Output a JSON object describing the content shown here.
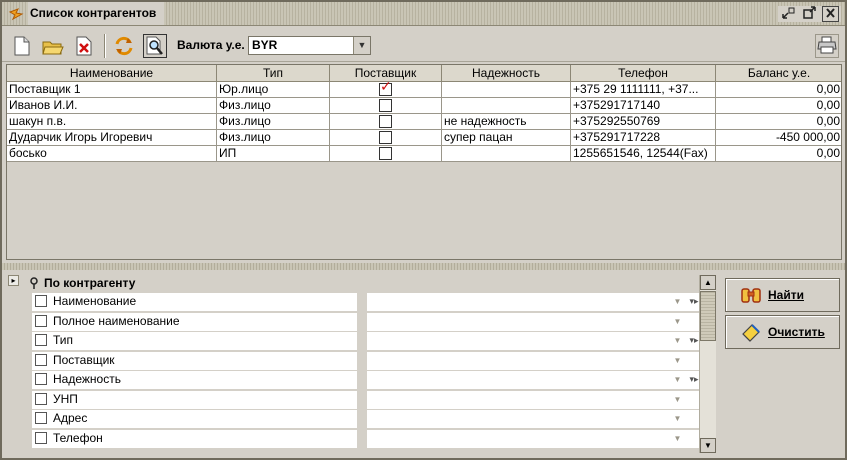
{
  "window": {
    "title": "Список контрагентов",
    "controls": {
      "minimize_label": "▫",
      "restore_label": "⇱",
      "close_label": "✕"
    }
  },
  "toolbar": {
    "currency_label": "Валюта у.е.",
    "currency_value": "BYR",
    "buttons": [
      "new-icon",
      "open-folder-icon",
      "delete-icon",
      "refresh-icon",
      "search-icon"
    ],
    "print_icon": "printer-icon"
  },
  "grid": {
    "columns": [
      "Наименование",
      "Тип",
      "Поставщик",
      "Надежность",
      "Телефон",
      "Баланс у.е."
    ],
    "rows": [
      {
        "name": "Поставщик 1",
        "type": "Юр.лицо",
        "supplier": true,
        "reliability": "",
        "phone": "+375 29 1111111, +37...",
        "balance": "0,00"
      },
      {
        "name": "Иванов И.И.",
        "type": "Физ.лицо",
        "supplier": false,
        "reliability": "",
        "phone": "+375291717140",
        "balance": "0,00"
      },
      {
        "name": "шакун п.в.",
        "type": "Физ.лицо",
        "supplier": false,
        "reliability": "не надежность",
        "phone": "+375292550769",
        "balance": "0,00"
      },
      {
        "name": "Дударчик Игорь Игоревич",
        "type": "Физ.лицо",
        "supplier": false,
        "reliability": "супер пацан",
        "phone": "+375291717228",
        "balance": "-450 000,00"
      },
      {
        "name": "босько",
        "type": "ИП",
        "supplier": false,
        "reliability": "",
        "phone": "1255651546, 12544(Fax)",
        "balance": "0,00"
      }
    ]
  },
  "filter": {
    "section_title": "По контрагенту",
    "fields": [
      {
        "label": "Наименование",
        "has_extra": true
      },
      {
        "label": "Полное наименование",
        "has_extra": false
      },
      {
        "label": "Тип",
        "has_extra": true
      },
      {
        "label": "Поставщик",
        "has_extra": false
      },
      {
        "label": "Надежность",
        "has_extra": true
      },
      {
        "label": "УНП",
        "has_extra": false
      },
      {
        "label": "Адрес",
        "has_extra": false
      },
      {
        "label": "Телефон",
        "has_extra": false
      }
    ]
  },
  "actions": {
    "find_label": "Найти",
    "find_mnemonic": "Н",
    "clear_label": "Очистить",
    "clear_mnemonic": "О"
  },
  "colors": {
    "accent": "#d01010",
    "window_bg": "#d4d0c8"
  }
}
